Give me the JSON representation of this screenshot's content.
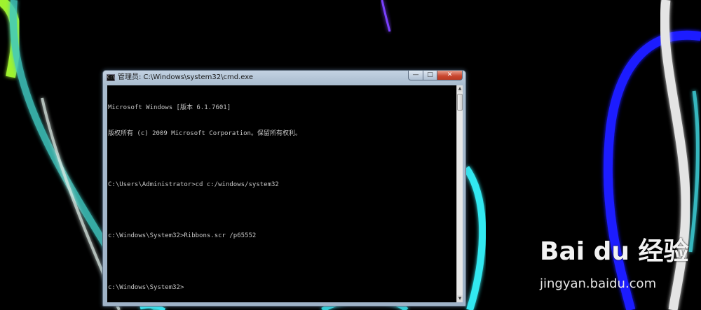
{
  "window": {
    "title": "管理员: C:\\Windows\\system32\\cmd.exe",
    "icon": "cmd-icon",
    "buttons": {
      "minimize": "—",
      "maximize": "□",
      "close": "✕"
    }
  },
  "console": {
    "lines": [
      "Microsoft Windows [版本 6.1.7601]",
      "版权所有 (c) 2009 Microsoft Corporation。保留所有权利。",
      "",
      "C:\\Users\\Administrator>cd c:/windows/system32",
      "",
      "c:\\Windows\\System32>Ribbons.scr /p65552",
      "",
      "c:\\Windows\\System32>"
    ]
  },
  "watermark": {
    "logo_text": "Bai du 经验",
    "url": "jingyan.baidu.com"
  },
  "colors": {
    "ribbon_cyan": "#3fe0e8",
    "ribbon_blue": "#2222ff",
    "ribbon_green": "#b8ff40",
    "ribbon_white": "#e8e8e8",
    "close_button": "#c8452d",
    "console_text": "#c8c8c8"
  }
}
